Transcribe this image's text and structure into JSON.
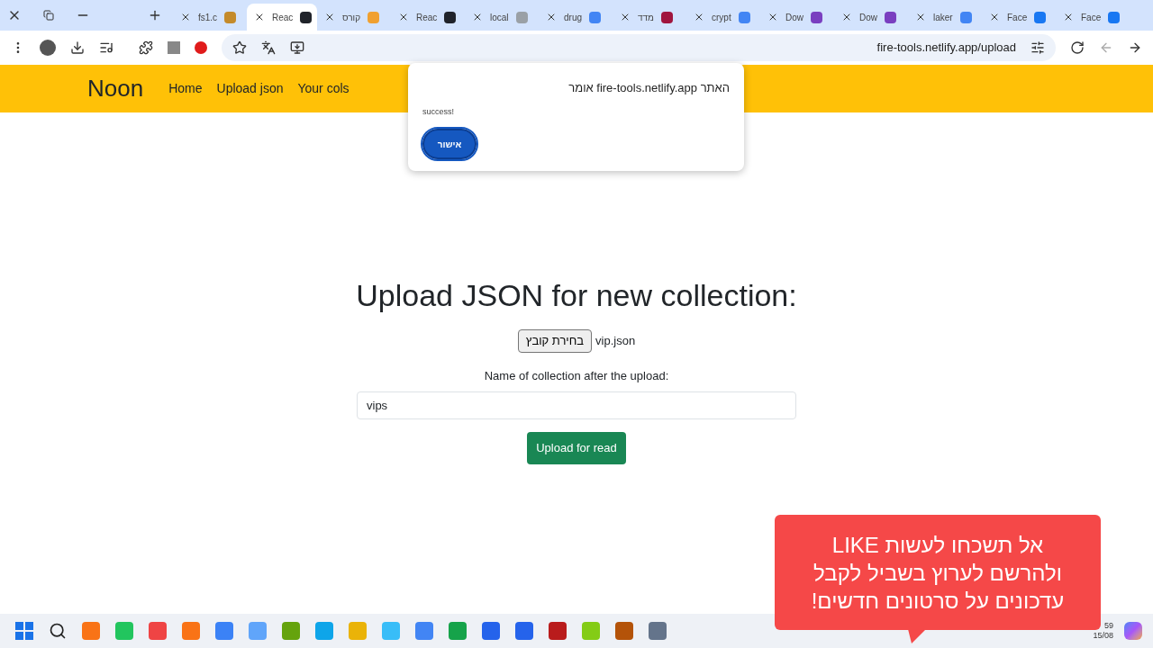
{
  "tabs": [
    {
      "label": "fs1.c",
      "selected": false
    },
    {
      "label": "Reac",
      "selected": true
    },
    {
      "label": "קורס",
      "selected": false
    },
    {
      "label": "Reac",
      "selected": false
    },
    {
      "label": "local",
      "selected": false
    },
    {
      "label": "drug",
      "selected": false
    },
    {
      "label": "מדד",
      "selected": false
    },
    {
      "label": "crypt",
      "selected": false
    },
    {
      "label": "Dow",
      "selected": false
    },
    {
      "label": "Dow",
      "selected": false
    },
    {
      "label": "laker",
      "selected": false
    },
    {
      "label": "Face",
      "selected": false
    },
    {
      "label": "Face",
      "selected": false
    }
  ],
  "address_bar": {
    "url": "fire-tools.netlify.app/upload"
  },
  "navbar": {
    "brand": "Noon",
    "links": [
      "Home",
      "Upload json",
      "Your cols"
    ]
  },
  "alert": {
    "title": "האתר fire-tools.netlify.app אומר",
    "message": "success!",
    "button": "אישור"
  },
  "upload": {
    "heading": "Upload JSON for new collection:",
    "file_button": "בחירת קובץ",
    "file_name": "vip.json",
    "name_label": "Name of collection after the upload:",
    "name_value": "vips",
    "submit": "Upload for read"
  },
  "callout": {
    "lines": [
      "אל תשכחו לעשות LIKE",
      "ולהרשם לערוץ בשביל לקבל",
      "עדכונים על סרטונים חדשים!"
    ]
  },
  "taskbar": {
    "clock_time": "59",
    "clock_date": "15/08"
  }
}
